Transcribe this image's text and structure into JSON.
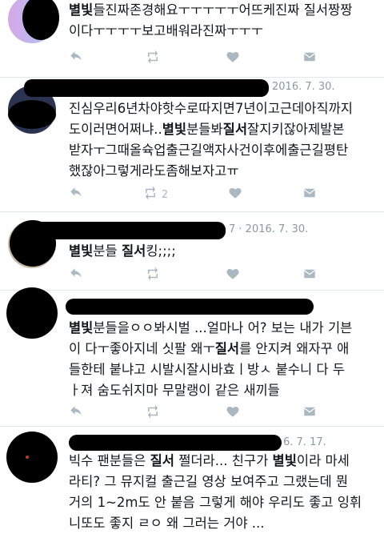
{
  "tweets": [
    {
      "id": "t1",
      "date": "",
      "text_parts": [
        {
          "t": "별빛",
          "b": true
        },
        {
          "t": "들진짜존경해요ㅜㅜㅜㅜㅜ어뜨케진짜 질서짱짱\n이다ㅜㅜㅜㅜ보고배워라진짜ㅜㅜㅜ",
          "b": false
        }
      ],
      "retweet_count": ""
    },
    {
      "id": "t2",
      "date": "2016. 7. 30.",
      "text_parts": [
        {
          "t": "진심우리6년차야핫수로따지면7년이고근데아직까지\n도이러면어쩌냐..",
          "b": false
        },
        {
          "t": "별빛",
          "b": true
        },
        {
          "t": "분들봐",
          "b": false
        },
        {
          "t": "질서",
          "b": true
        },
        {
          "t": "잘지키잖아제발본\n받자ㅜ그때올슉업출근길액자사건이후에출근길평탄\n했잖아그렇게라도좀해보자고ㅠ",
          "b": false
        }
      ],
      "retweet_count": "2"
    },
    {
      "id": "t3",
      "date": "7 · 2016. 7. 30.",
      "text_parts": [
        {
          "t": "별빛",
          "b": true
        },
        {
          "t": "분들 ",
          "b": false
        },
        {
          "t": "질서",
          "b": true
        },
        {
          "t": "킹;;;;",
          "b": false
        }
      ],
      "retweet_count": ""
    },
    {
      "id": "t4",
      "date": "",
      "text_parts": [
        {
          "t": "별빛",
          "b": true
        },
        {
          "t": "분들을ㅇㅇ봐시벌 ...얼마나 어? 보는 내가 기븐\n이 다ㅜ좋아지네 싯팔 왜ㅜ",
          "b": false
        },
        {
          "t": "질서",
          "b": true
        },
        {
          "t": "를 안지켜 왜자꾸 애\n들한테 붙냐고 시발시잘시바효ㅣ방ㅅ 붙수니 다 두\nㅏ져 숨도쉬지마 무말랭이 같은 새끼들",
          "b": false
        }
      ],
      "retweet_count": ""
    },
    {
      "id": "t5",
      "date": "6. 7. 17.",
      "text_parts": [
        {
          "t": "빅수 팬분들은 ",
          "b": false
        },
        {
          "t": "질서",
          "b": true
        },
        {
          "t": " 쩔더라... 친구가 ",
          "b": false
        },
        {
          "t": "별빛",
          "b": true
        },
        {
          "t": "이라 마세\n라티? 그 뮤지컬 출근길 영상 보여주고 그랬는데 뭔\n거의 1~2m도 안 붙음 그렇게 해야 우리도 좋고 잉휘\n니또도 좋지 ㄹㅇ 왜 그러는 거야 ...",
          "b": false
        }
      ],
      "retweet_count": ""
    }
  ],
  "icons": {
    "reply": "reply-icon",
    "retweet": "retweet-icon",
    "like": "heart-icon",
    "dm": "mail-icon"
  },
  "colors": {
    "text": "#14171a",
    "meta": "#8899a6",
    "action": "#aab8c2",
    "divider": "#e1e8ed"
  }
}
